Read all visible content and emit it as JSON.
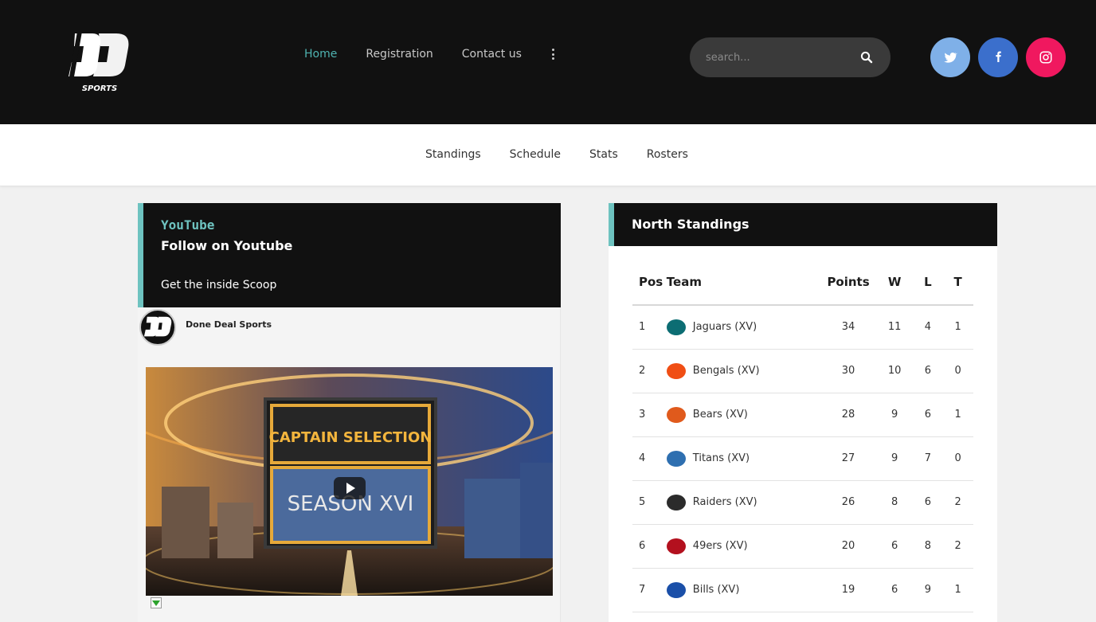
{
  "header": {
    "logo_text": "DD SPORTS",
    "nav": [
      {
        "label": "Home",
        "active": true
      },
      {
        "label": "Registration",
        "active": false
      },
      {
        "label": "Contact us",
        "active": false
      }
    ],
    "more_icon": "kebab-icon",
    "search": {
      "placeholder": "search...",
      "icon": "search-icon"
    },
    "social": [
      {
        "name": "twitter",
        "icon": "twitter-icon",
        "color": "#7fb0e8"
      },
      {
        "name": "facebook",
        "icon": "facebook-icon",
        "color": "#3b6fcc"
      },
      {
        "name": "instagram",
        "icon": "instagram-icon",
        "color": "#f0185f"
      }
    ]
  },
  "subnav": [
    "Standings",
    "Schedule",
    "Stats",
    "Rosters"
  ],
  "youtube": {
    "kicker": "YouTube",
    "title": "Follow on Youtube",
    "subtitle": "Get the inside Scoop",
    "channel_name": "Done Deal Sports",
    "video": {
      "line1": "CAPTAIN SELECTION",
      "line2": "SEASON XVI"
    }
  },
  "standings": {
    "title": "North Standings",
    "columns": [
      "Pos",
      "Team",
      "Points",
      "W",
      "L",
      "T"
    ],
    "rows": [
      {
        "pos": "1",
        "team": "Jaguars (XV)",
        "points": "34",
        "w": "11",
        "l": "4",
        "t": "1",
        "color": "#0c6d73"
      },
      {
        "pos": "2",
        "team": "Bengals (XV)",
        "points": "30",
        "w": "10",
        "l": "6",
        "t": "0",
        "color": "#f04e14"
      },
      {
        "pos": "3",
        "team": "Bears (XV)",
        "points": "28",
        "w": "9",
        "l": "6",
        "t": "1",
        "color": "#e05a1c"
      },
      {
        "pos": "4",
        "team": "Titans (XV)",
        "points": "27",
        "w": "9",
        "l": "7",
        "t": "0",
        "color": "#2e6fb0"
      },
      {
        "pos": "5",
        "team": "Raiders (XV)",
        "points": "26",
        "w": "8",
        "l": "6",
        "t": "2",
        "color": "#2b2b2b"
      },
      {
        "pos": "6",
        "team": "49ers (XV)",
        "points": "20",
        "w": "6",
        "l": "8",
        "t": "2",
        "color": "#b3101e"
      },
      {
        "pos": "7",
        "team": "Bills (XV)",
        "points": "19",
        "w": "6",
        "l": "9",
        "t": "1",
        "color": "#1a4fa8"
      }
    ]
  }
}
